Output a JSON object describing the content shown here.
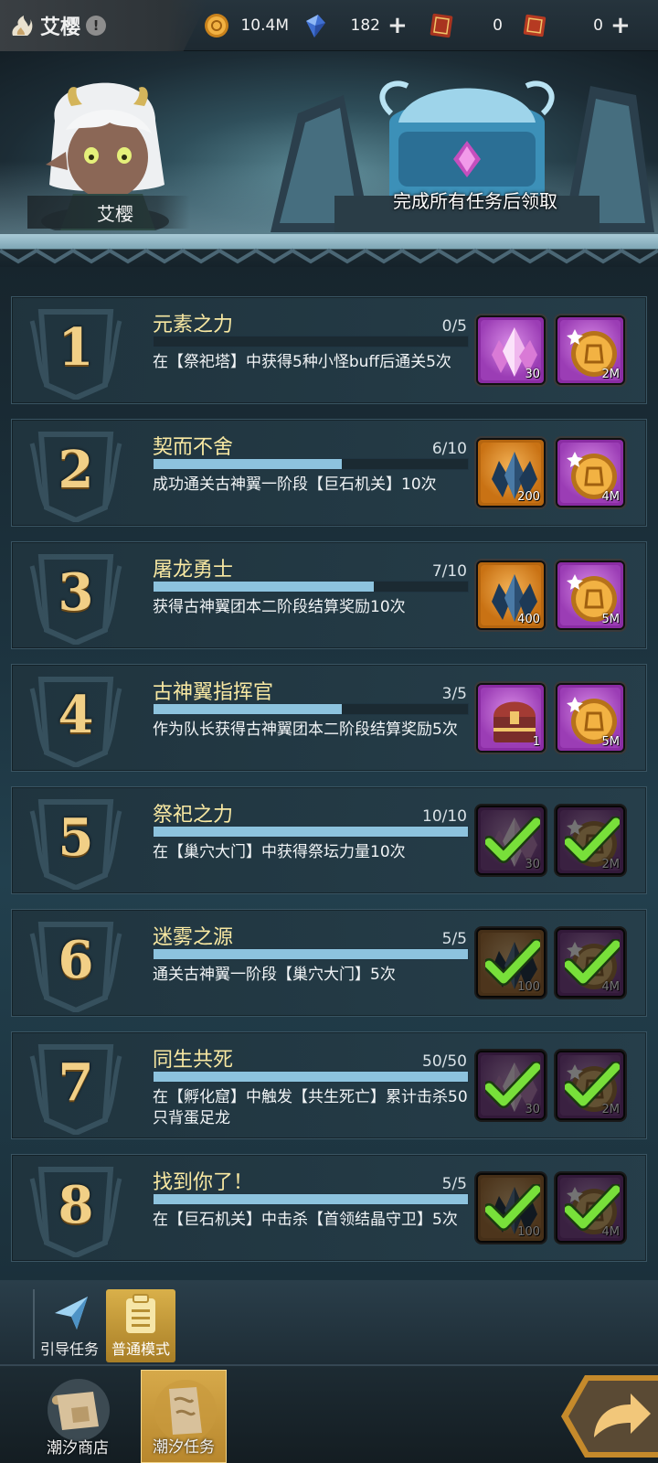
{
  "hero": {
    "name": "艾樱",
    "info_icon": "exclamation-icon",
    "label": "艾樱"
  },
  "currencies": [
    {
      "icon": "gold-coin-icon",
      "value": "10.4M",
      "has_plus": false
    },
    {
      "icon": "blue-crystal-icon",
      "value": "182",
      "has_plus": true
    },
    {
      "icon": "red-ticket-icon",
      "value": "0",
      "has_plus": false
    },
    {
      "icon": "red-scroll-ticket-icon",
      "value": "0",
      "has_plus": true
    }
  ],
  "banner": {
    "chest_label": "完成所有任务后领取"
  },
  "tasks": [
    {
      "num": "1",
      "title": "元素之力",
      "count": "0/5",
      "progress": 0.0,
      "desc": "在【祭祀塔】中获得5种小怪buff后通关5次",
      "rewards": [
        {
          "type": "pink-crystal",
          "qty": "30",
          "frame": "purple"
        },
        {
          "type": "gold-coin",
          "qty": "2M",
          "frame": "purple"
        }
      ],
      "completed": false
    },
    {
      "num": "2",
      "title": "契而不舍",
      "count": "6/10",
      "progress": 0.6,
      "desc": "成功通关古神翼一阶段【巨石机关】10次",
      "rewards": [
        {
          "type": "dark-crystal",
          "qty": "200",
          "frame": "orange"
        },
        {
          "type": "gold-coin",
          "qty": "4M",
          "frame": "purple"
        }
      ],
      "completed": false
    },
    {
      "num": "3",
      "title": "屠龙勇士",
      "count": "7/10",
      "progress": 0.7,
      "desc": "获得古神翼团本二阶段结算奖励10次",
      "rewards": [
        {
          "type": "dark-crystal",
          "qty": "400",
          "frame": "orange"
        },
        {
          "type": "gold-coin",
          "qty": "5M",
          "frame": "purple"
        }
      ],
      "completed": false
    },
    {
      "num": "4",
      "title": "古神翼指挥官",
      "count": "3/5",
      "progress": 0.6,
      "desc": "作为队长获得古神翼团本二阶段结算奖励5次",
      "rewards": [
        {
          "type": "treasure-chest",
          "qty": "1",
          "frame": "purple"
        },
        {
          "type": "gold-coin",
          "qty": "5M",
          "frame": "purple"
        }
      ],
      "completed": false
    },
    {
      "num": "5",
      "title": "祭祀之力",
      "count": "10/10",
      "progress": 1.0,
      "desc": "在【巢穴大门】中获得祭坛力量10次",
      "rewards": [
        {
          "type": "pink-crystal",
          "qty": "30",
          "frame": "purple"
        },
        {
          "type": "gold-coin",
          "qty": "2M",
          "frame": "purple"
        }
      ],
      "completed": true
    },
    {
      "num": "6",
      "title": "迷雾之源",
      "count": "5/5",
      "progress": 1.0,
      "desc": "通关古神翼一阶段【巢穴大门】5次",
      "rewards": [
        {
          "type": "dark-crystal",
          "qty": "100",
          "frame": "orange"
        },
        {
          "type": "gold-coin",
          "qty": "4M",
          "frame": "purple"
        }
      ],
      "completed": true
    },
    {
      "num": "7",
      "title": "同生共死",
      "count": "50/50",
      "progress": 1.0,
      "desc": "在【孵化窟】中触发【共生死亡】累计击杀50只背蛋足龙",
      "rewards": [
        {
          "type": "pink-crystal",
          "qty": "30",
          "frame": "purple"
        },
        {
          "type": "gold-coin",
          "qty": "2M",
          "frame": "purple"
        }
      ],
      "completed": true
    },
    {
      "num": "8",
      "title": "找到你了！",
      "count": "5/5",
      "progress": 1.0,
      "desc": "在【巨石机关】中击杀【首领结晶守卫】5次",
      "rewards": [
        {
          "type": "dark-crystal",
          "qty": "100",
          "frame": "orange"
        },
        {
          "type": "gold-coin",
          "qty": "4M",
          "frame": "purple"
        }
      ],
      "completed": true
    }
  ],
  "mode_tabs": [
    {
      "label": "引导任务",
      "icon": "paper-plane-icon",
      "active": false
    },
    {
      "label": "普通模式",
      "icon": "clipboard-icon",
      "active": true
    }
  ],
  "nav": [
    {
      "label": "潮汐商店",
      "icon": "scroll-shop-icon",
      "active": false
    },
    {
      "label": "潮汐任务",
      "icon": "scroll-quest-icon",
      "active": true
    }
  ],
  "next_button_icon": "share-arrow-icon"
}
